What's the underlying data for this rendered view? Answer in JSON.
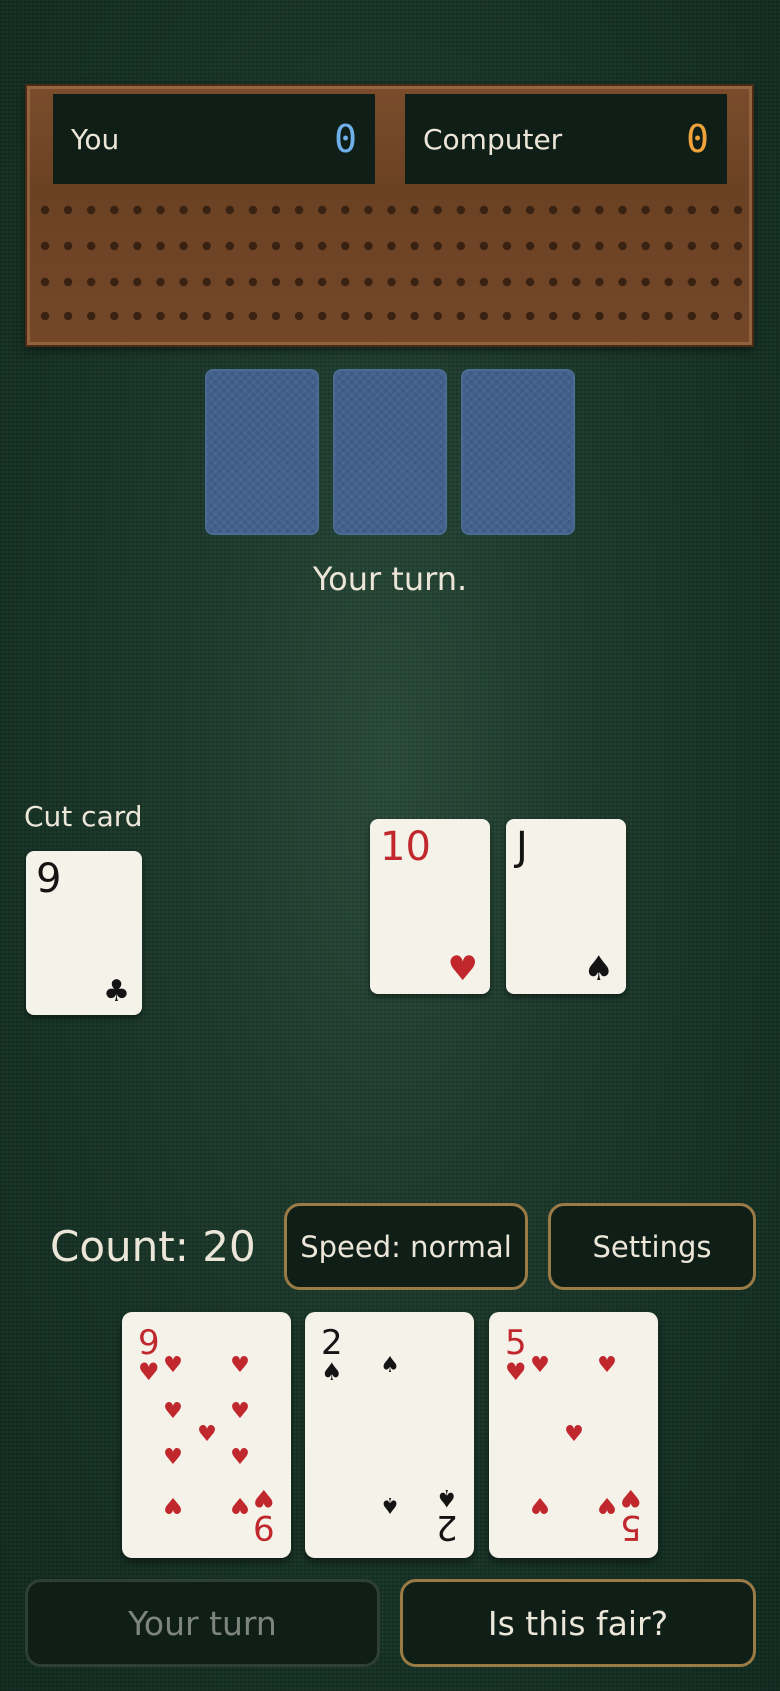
{
  "board": {
    "player_name": "You",
    "player_score": "0",
    "computer_name": "Computer",
    "computer_score": "0"
  },
  "computer_hand": {
    "face_down_count": 3
  },
  "status_message": "Your turn.",
  "cut_card": {
    "label": "Cut card",
    "rank": "9",
    "suit": "♣"
  },
  "played_cards": [
    {
      "rank": "10",
      "suit": "♥"
    },
    {
      "rank": "J",
      "suit": "♠"
    }
  ],
  "count": {
    "text": "Count: 20"
  },
  "buttons": {
    "speed": "Speed: normal",
    "settings": "Settings",
    "your_turn": "Your turn",
    "is_fair": "Is this fair?"
  },
  "player_hand": [
    {
      "rank": "9",
      "suit": "♥"
    },
    {
      "rank": "2",
      "suit": "♠"
    },
    {
      "rank": "5",
      "suit": "♥"
    }
  ],
  "colors": {
    "player_peg": "#6fb0ea",
    "computer_peg": "#f0a23a",
    "red_suit": "#c0282d",
    "black_suit": "#141414",
    "button_border": "#9a7a45"
  }
}
